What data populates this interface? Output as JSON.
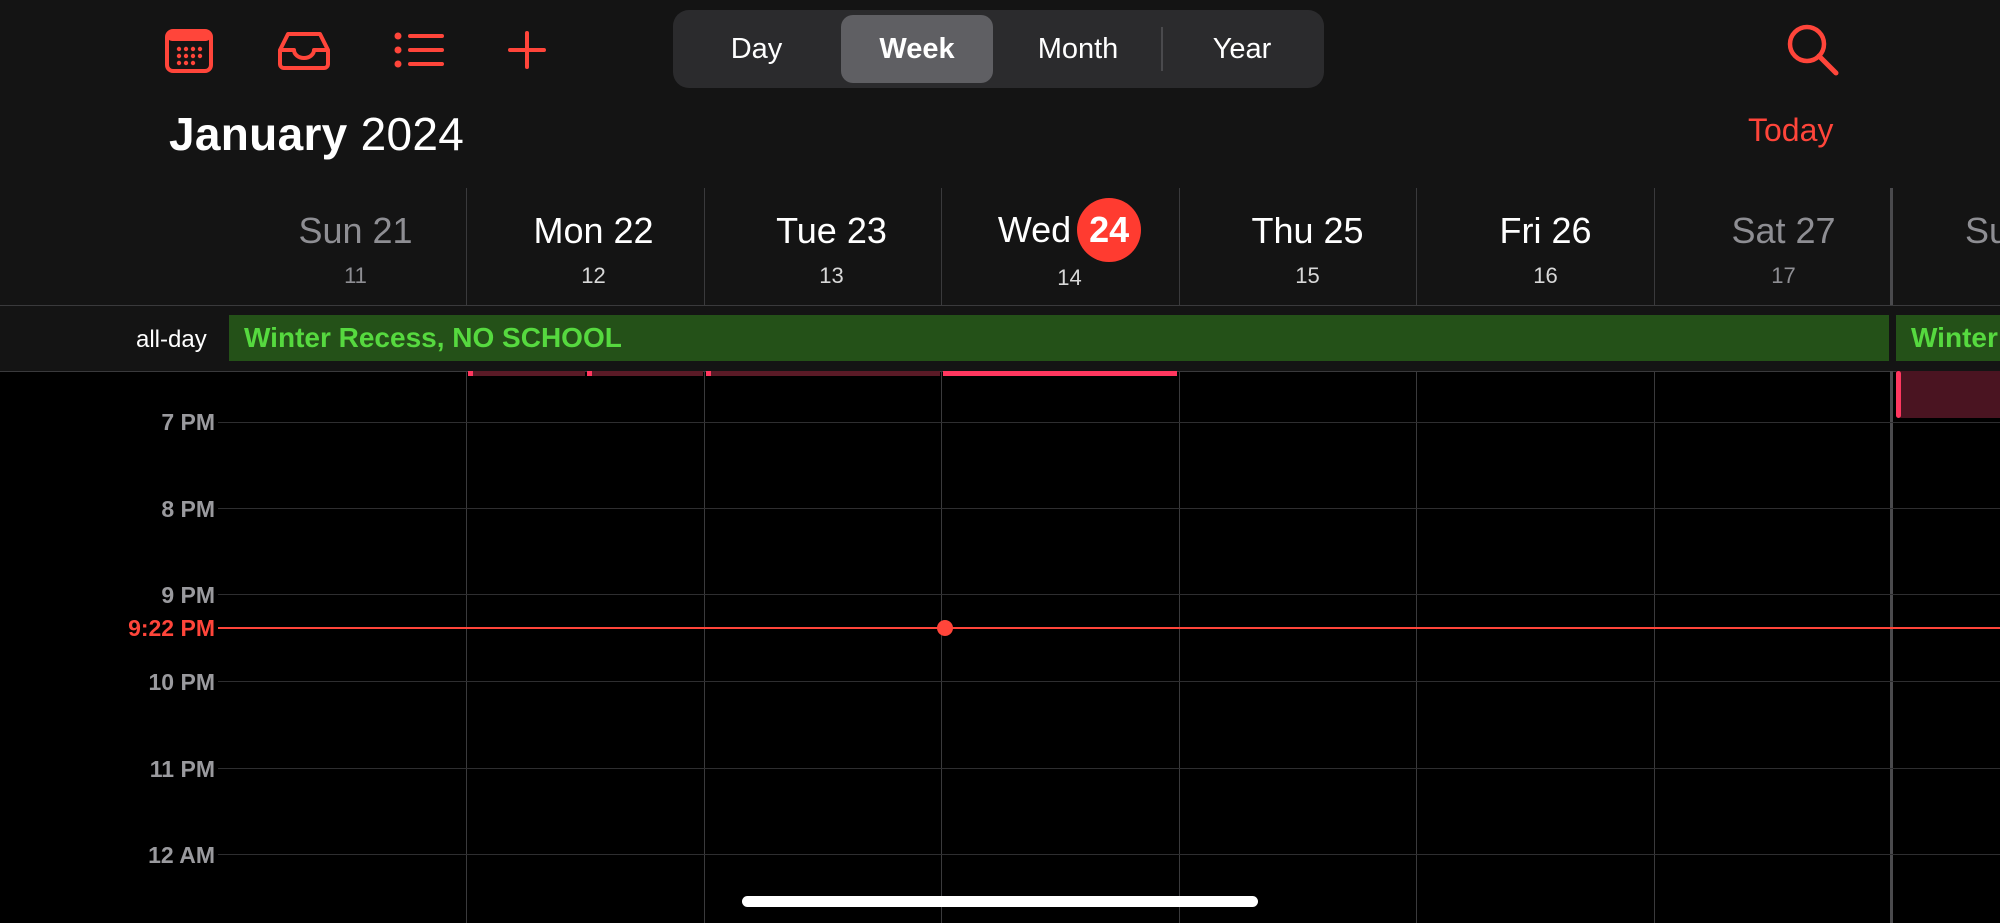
{
  "toolbar": {
    "icons": [
      "calendar-grid-icon",
      "inbox-tray-icon",
      "list-icon",
      "plus-icon",
      "search-icon"
    ],
    "view_switcher": {
      "options": [
        "Day",
        "Week",
        "Month",
        "Year"
      ],
      "selected": "Week"
    }
  },
  "header": {
    "month": "January",
    "year": "2024",
    "today_label": "Today"
  },
  "week_days": [
    {
      "name": "Sun 21",
      "lunar": "11",
      "weekend": true
    },
    {
      "name": "Mon 22",
      "lunar": "12",
      "weekend": false
    },
    {
      "name": "Tue 23",
      "lunar": "13",
      "weekend": false
    },
    {
      "name": "Wed",
      "badge": "24",
      "lunar": "14",
      "weekend": false,
      "is_today": true
    },
    {
      "name": "Thu 25",
      "lunar": "15",
      "weekend": false
    },
    {
      "name": "Fri 26",
      "lunar": "16",
      "weekend": false
    },
    {
      "name": "Sat 27",
      "lunar": "17",
      "weekend": true
    },
    {
      "name": "Su",
      "weekend": true
    }
  ],
  "all_day": {
    "label": "all-day",
    "events": [
      {
        "title": "Winter Recess, NO SCHOOL"
      },
      {
        "title": "Winter Recess, NO SCHOOL"
      }
    ]
  },
  "timeline": {
    "hours": [
      "7 PM",
      "8 PM",
      "9 PM",
      "10 PM",
      "11 PM",
      "12 AM"
    ],
    "current_time": "9:22 PM"
  },
  "colors": {
    "accent": "#ff453a",
    "allday_event_bg": "#245118",
    "allday_event_text": "#56d93f",
    "timed_event": "#ff375f"
  }
}
